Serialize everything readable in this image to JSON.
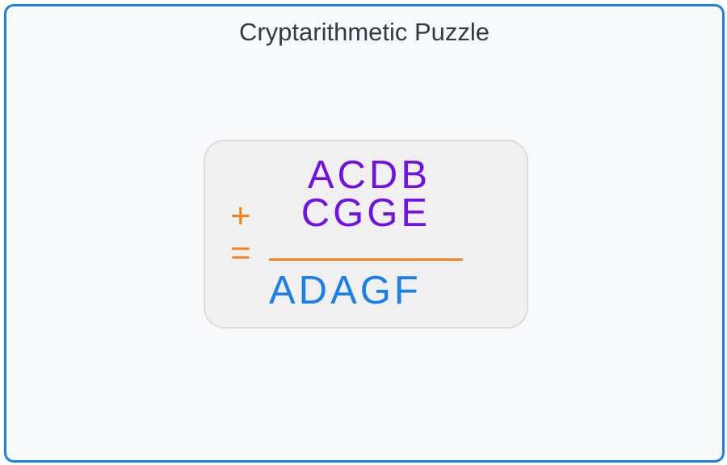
{
  "title": "Cryptarithmetic Puzzle",
  "puzzle": {
    "addend1": "ACDB",
    "addend2": "CGGE",
    "operator": "+",
    "equals": "=",
    "result": "ADAGF"
  },
  "colors": {
    "frame_border": "#1a7fe8",
    "addends": "#6f12e6",
    "operators": "#f5821f",
    "result": "#1a7fe8",
    "title": "#333a45"
  }
}
